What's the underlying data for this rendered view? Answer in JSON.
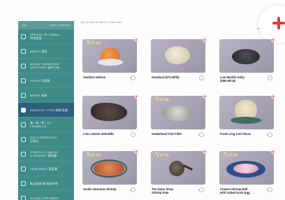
{
  "search": {
    "text": "Tap an item to add it to your order"
  },
  "sidebar": {
    "top_left": "ITEM",
    "top_right": "MENU CATEGORY",
    "items": [
      {
        "label": "SPECIAL SET MENU\n特別套餐"
      },
      {
        "label": "BROTH 湯底"
      },
      {
        "label": "MACAU SIGNATURE\nAPPETIZER 澳門小吃"
      },
      {
        "label": "TOFFU 豆腐類"
      },
      {
        "label": "MEATS 肉類"
      },
      {
        "label": "SEAFOOD / FISH 海鮮/魚類"
      },
      {
        "label": "蛋 / 肉 / 魚 / 丸 /\nFISHBALLS"
      },
      {
        "label": "SOY'S PRODUCTS\n豆製品"
      },
      {
        "label": "STARCH & SNACKS\n& DESSERT 澱粉類"
      },
      {
        "label": "VEGETABLE 蔬菜類"
      },
      {
        "label": "飲品雜貨/酒/高級特色"
      },
      {
        "label": "GLOBAL PARTNERS"
      }
    ]
  },
  "products": [
    {
      "name": "Sashimi Salmon",
      "price": "58.00",
      "unit": "1 份/每件",
      "new": true
    },
    {
      "name": "Geoduck ($75.00/lb)",
      "price": "7.00",
      "unit": "1 份/每件",
      "new": false
    },
    {
      "name": "Live Marble Goby\n($58.00/LB)",
      "price": "0.00",
      "unit": "1 份/每件",
      "new": false
    },
    {
      "name": "Live Lobster $28.99/lb",
      "price": "0.00",
      "unit": "1 份/每件",
      "new": false
    },
    {
      "name": "Snakehead Fish Fillet",
      "price": "22.00",
      "unit": "1 份/每件",
      "new": true
    },
    {
      "name": "Fresh Ling Cod Slices",
      "price": "22.00",
      "unit": "1 份/每件",
      "new": false
    },
    {
      "name": "South American Shrimp",
      "price": "18.00",
      "unit": "1 份/每件",
      "new": true
    },
    {
      "name": "The Dolar Shop\nShrimp Pate",
      "price": "18.00",
      "unit": "1 份/每件",
      "new": true
    },
    {
      "name": "Cheese Shrimp Ball\nwith Salted Duck Egg",
      "price": "18.00",
      "unit": "1 份/每件",
      "new": true
    }
  ],
  "icons": {
    "add": "plus-icon"
  },
  "colors": {
    "sidebar": "#3f8b88",
    "active": "#2e5f7c",
    "accent": "#e63b3b",
    "card_bg": "#a9a5b4"
  }
}
